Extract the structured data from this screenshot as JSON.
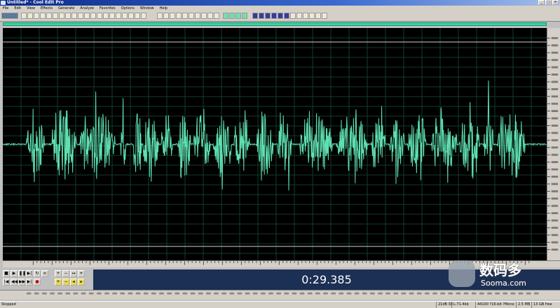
{
  "window": {
    "title": "Untitled* - Cool Edit Pro"
  },
  "menu": [
    "File",
    "Edit",
    "View",
    "Effects",
    "Generate",
    "Analyze",
    "Favorites",
    "Options",
    "Window",
    "Help"
  ],
  "time_display": "0:29.385",
  "status": {
    "left": "Stopped",
    "panels": [
      "21dB 38",
      "L:71.4kb",
      "44100 ?16-bit ?Mono",
      "2.5 MB",
      "13 GB free"
    ]
  },
  "watermark": {
    "cn": "数码多",
    "url": "Sooma.com"
  },
  "colors": {
    "waveform": "#5fe0b0",
    "background": "#000000",
    "grid": "#123c2e",
    "display_bg": "#1c2f54"
  },
  "icons": {
    "transport": [
      "stop-icon",
      "play-icon",
      "pause-icon",
      "play-to-end-icon",
      "loop-icon",
      "go-to-start-icon",
      "rewind-icon",
      "fast-forward-icon",
      "go-to-end-icon",
      "record-icon"
    ],
    "zoom": [
      "zoom-in-horizontal-icon",
      "zoom-out-horizontal-icon",
      "zoom-full-icon",
      "zoom-in-vertical-icon",
      "zoom-out-vertical-icon",
      "zoom-selection-icon"
    ]
  }
}
